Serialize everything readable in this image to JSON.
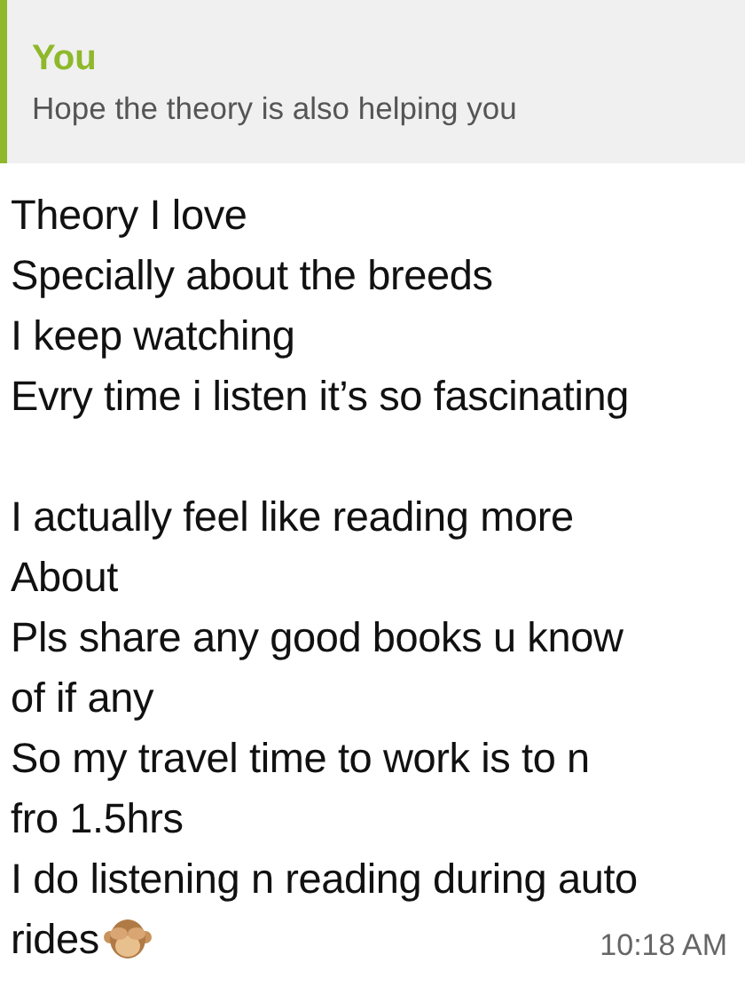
{
  "quote": {
    "author": "You",
    "text": "Hope the theory is also helping you"
  },
  "message": {
    "paragraphs": [
      [
        "Theory I love",
        "Specially about the breeds",
        "I keep watching",
        "Evry time i listen it’s so fascinating"
      ],
      [
        "I actually feel like reading more",
        "About",
        "Pls share any good books u know",
        "of if any",
        "So my travel time to work is to n",
        "fro 1.5hrs",
        "I do listening n reading during auto",
        "rides"
      ]
    ],
    "time": "10:18 AM"
  }
}
